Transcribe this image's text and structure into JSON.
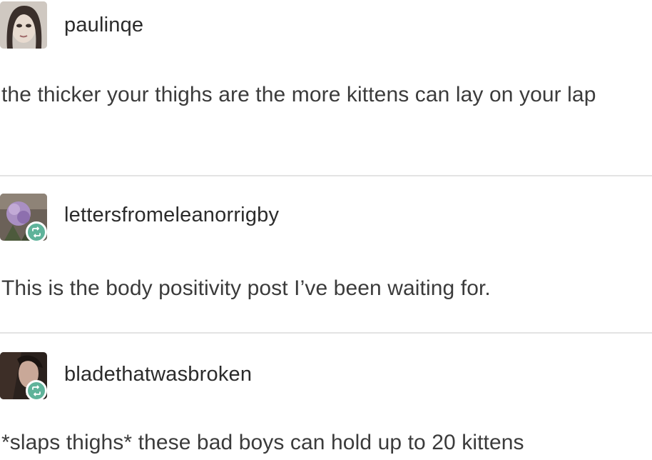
{
  "posts": [
    {
      "username": "paulinqe",
      "avatar_icon": "user-avatar-photo",
      "text": "the thicker your thighs are the more kittens can lay on your lap",
      "reblog": false
    },
    {
      "username": "lettersfromeleanorrigby",
      "avatar_icon": "user-avatar-photo",
      "text": "This is the body positivity post I’ve been waiting for.",
      "reblog": true,
      "reblog_icon": "reblog-icon"
    },
    {
      "username": "bladethatwasbroken",
      "avatar_icon": "user-avatar-photo",
      "text": "*slaps thighs* these bad boys can hold up to 20 kittens",
      "reblog": true,
      "reblog_icon": "reblog-icon"
    }
  ],
  "colors": {
    "reblog_badge": "#5fb39a",
    "divider": "#e3e3e3",
    "text": "#3b3b3b"
  }
}
